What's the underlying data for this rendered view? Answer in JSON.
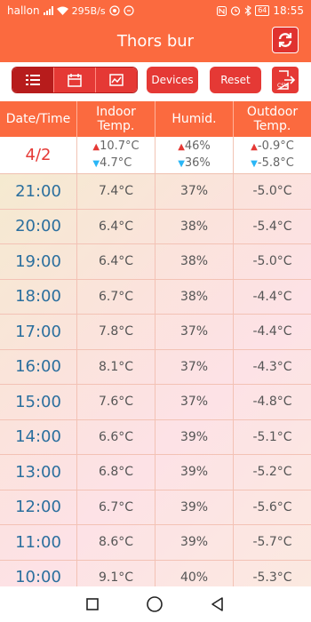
{
  "status_bar": {
    "carrier": "hallon",
    "speed": "295B/s",
    "battery": "64",
    "time": "18:55"
  },
  "header": {
    "title": "Thors bur"
  },
  "toolbar": {
    "devices_label": "Devices",
    "reset_label": "Reset",
    "csv_label": "CSV"
  },
  "table": {
    "headers": [
      "Date/Time",
      "Indoor Temp.",
      "Humid.",
      "Outdoor Temp."
    ],
    "summary": {
      "date": "4/2",
      "indoor_max": "10.7°C",
      "indoor_min": "4.7°C",
      "humid_max": "46%",
      "humid_min": "36%",
      "outdoor_max": "-0.9°C",
      "outdoor_min": "-5.8°C"
    },
    "rows": [
      {
        "time": "21:00",
        "indoor": "7.4°C",
        "humid": "37%",
        "outdoor": "-5.0°C"
      },
      {
        "time": "20:00",
        "indoor": "6.4°C",
        "humid": "38%",
        "outdoor": "-5.4°C"
      },
      {
        "time": "19:00",
        "indoor": "6.4°C",
        "humid": "38%",
        "outdoor": "-5.0°C"
      },
      {
        "time": "18:00",
        "indoor": "6.7°C",
        "humid": "38%",
        "outdoor": "-4.4°C"
      },
      {
        "time": "17:00",
        "indoor": "7.8°C",
        "humid": "37%",
        "outdoor": "-4.4°C"
      },
      {
        "time": "16:00",
        "indoor": "8.1°C",
        "humid": "37%",
        "outdoor": "-4.3°C"
      },
      {
        "time": "15:00",
        "indoor": "7.6°C",
        "humid": "37%",
        "outdoor": "-4.8°C"
      },
      {
        "time": "14:00",
        "indoor": "6.6°C",
        "humid": "39%",
        "outdoor": "-5.1°C"
      },
      {
        "time": "13:00",
        "indoor": "6.8°C",
        "humid": "39%",
        "outdoor": "-5.2°C"
      },
      {
        "time": "12:00",
        "indoor": "6.7°C",
        "humid": "39%",
        "outdoor": "-5.6°C"
      },
      {
        "time": "11:00",
        "indoor": "8.6°C",
        "humid": "39%",
        "outdoor": "-5.7°C"
      },
      {
        "time": "10:00",
        "indoor": "9.1°C",
        "humid": "40%",
        "outdoor": "-5.3°C"
      }
    ]
  },
  "colors": {
    "accent": "#fb6a3f",
    "button_red": "#e53935",
    "time_blue": "#2b6f9e",
    "up_arrow": "#e53935",
    "down_arrow": "#29b6f6"
  },
  "icons": [
    "wifi-icon",
    "signal-icon",
    "nfc-icon",
    "alarm-icon",
    "bluetooth-icon",
    "refresh-icon",
    "list-view-icon",
    "calendar-icon",
    "chart-icon",
    "csv-export-icon",
    "back-icon",
    "home-icon",
    "recents-icon"
  ]
}
